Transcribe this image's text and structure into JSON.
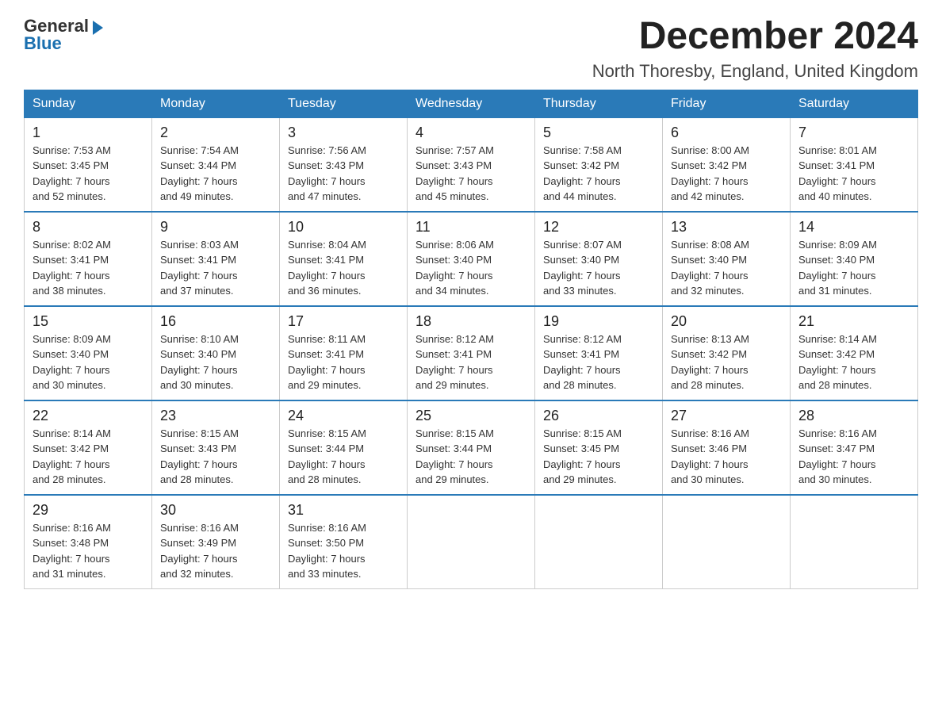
{
  "header": {
    "logo_text_general": "General",
    "logo_text_blue": "Blue",
    "month_title": "December 2024",
    "location": "North Thoresby, England, United Kingdom"
  },
  "weekdays": [
    "Sunday",
    "Monday",
    "Tuesday",
    "Wednesday",
    "Thursday",
    "Friday",
    "Saturday"
  ],
  "weeks": [
    [
      {
        "day": "1",
        "sunrise": "7:53 AM",
        "sunset": "3:45 PM",
        "daylight": "7 hours and 52 minutes."
      },
      {
        "day": "2",
        "sunrise": "7:54 AM",
        "sunset": "3:44 PM",
        "daylight": "7 hours and 49 minutes."
      },
      {
        "day": "3",
        "sunrise": "7:56 AM",
        "sunset": "3:43 PM",
        "daylight": "7 hours and 47 minutes."
      },
      {
        "day": "4",
        "sunrise": "7:57 AM",
        "sunset": "3:43 PM",
        "daylight": "7 hours and 45 minutes."
      },
      {
        "day": "5",
        "sunrise": "7:58 AM",
        "sunset": "3:42 PM",
        "daylight": "7 hours and 44 minutes."
      },
      {
        "day": "6",
        "sunrise": "8:00 AM",
        "sunset": "3:42 PM",
        "daylight": "7 hours and 42 minutes."
      },
      {
        "day": "7",
        "sunrise": "8:01 AM",
        "sunset": "3:41 PM",
        "daylight": "7 hours and 40 minutes."
      }
    ],
    [
      {
        "day": "8",
        "sunrise": "8:02 AM",
        "sunset": "3:41 PM",
        "daylight": "7 hours and 38 minutes."
      },
      {
        "day": "9",
        "sunrise": "8:03 AM",
        "sunset": "3:41 PM",
        "daylight": "7 hours and 37 minutes."
      },
      {
        "day": "10",
        "sunrise": "8:04 AM",
        "sunset": "3:41 PM",
        "daylight": "7 hours and 36 minutes."
      },
      {
        "day": "11",
        "sunrise": "8:06 AM",
        "sunset": "3:40 PM",
        "daylight": "7 hours and 34 minutes."
      },
      {
        "day": "12",
        "sunrise": "8:07 AM",
        "sunset": "3:40 PM",
        "daylight": "7 hours and 33 minutes."
      },
      {
        "day": "13",
        "sunrise": "8:08 AM",
        "sunset": "3:40 PM",
        "daylight": "7 hours and 32 minutes."
      },
      {
        "day": "14",
        "sunrise": "8:09 AM",
        "sunset": "3:40 PM",
        "daylight": "7 hours and 31 minutes."
      }
    ],
    [
      {
        "day": "15",
        "sunrise": "8:09 AM",
        "sunset": "3:40 PM",
        "daylight": "7 hours and 30 minutes."
      },
      {
        "day": "16",
        "sunrise": "8:10 AM",
        "sunset": "3:40 PM",
        "daylight": "7 hours and 30 minutes."
      },
      {
        "day": "17",
        "sunrise": "8:11 AM",
        "sunset": "3:41 PM",
        "daylight": "7 hours and 29 minutes."
      },
      {
        "day": "18",
        "sunrise": "8:12 AM",
        "sunset": "3:41 PM",
        "daylight": "7 hours and 29 minutes."
      },
      {
        "day": "19",
        "sunrise": "8:12 AM",
        "sunset": "3:41 PM",
        "daylight": "7 hours and 28 minutes."
      },
      {
        "day": "20",
        "sunrise": "8:13 AM",
        "sunset": "3:42 PM",
        "daylight": "7 hours and 28 minutes."
      },
      {
        "day": "21",
        "sunrise": "8:14 AM",
        "sunset": "3:42 PM",
        "daylight": "7 hours and 28 minutes."
      }
    ],
    [
      {
        "day": "22",
        "sunrise": "8:14 AM",
        "sunset": "3:42 PM",
        "daylight": "7 hours and 28 minutes."
      },
      {
        "day": "23",
        "sunrise": "8:15 AM",
        "sunset": "3:43 PM",
        "daylight": "7 hours and 28 minutes."
      },
      {
        "day": "24",
        "sunrise": "8:15 AM",
        "sunset": "3:44 PM",
        "daylight": "7 hours and 28 minutes."
      },
      {
        "day": "25",
        "sunrise": "8:15 AM",
        "sunset": "3:44 PM",
        "daylight": "7 hours and 29 minutes."
      },
      {
        "day": "26",
        "sunrise": "8:15 AM",
        "sunset": "3:45 PM",
        "daylight": "7 hours and 29 minutes."
      },
      {
        "day": "27",
        "sunrise": "8:16 AM",
        "sunset": "3:46 PM",
        "daylight": "7 hours and 30 minutes."
      },
      {
        "day": "28",
        "sunrise": "8:16 AM",
        "sunset": "3:47 PM",
        "daylight": "7 hours and 30 minutes."
      }
    ],
    [
      {
        "day": "29",
        "sunrise": "8:16 AM",
        "sunset": "3:48 PM",
        "daylight": "7 hours and 31 minutes."
      },
      {
        "day": "30",
        "sunrise": "8:16 AM",
        "sunset": "3:49 PM",
        "daylight": "7 hours and 32 minutes."
      },
      {
        "day": "31",
        "sunrise": "8:16 AM",
        "sunset": "3:50 PM",
        "daylight": "7 hours and 33 minutes."
      },
      null,
      null,
      null,
      null
    ]
  ],
  "labels": {
    "sunrise": "Sunrise:",
    "sunset": "Sunset:",
    "daylight": "Daylight:"
  }
}
